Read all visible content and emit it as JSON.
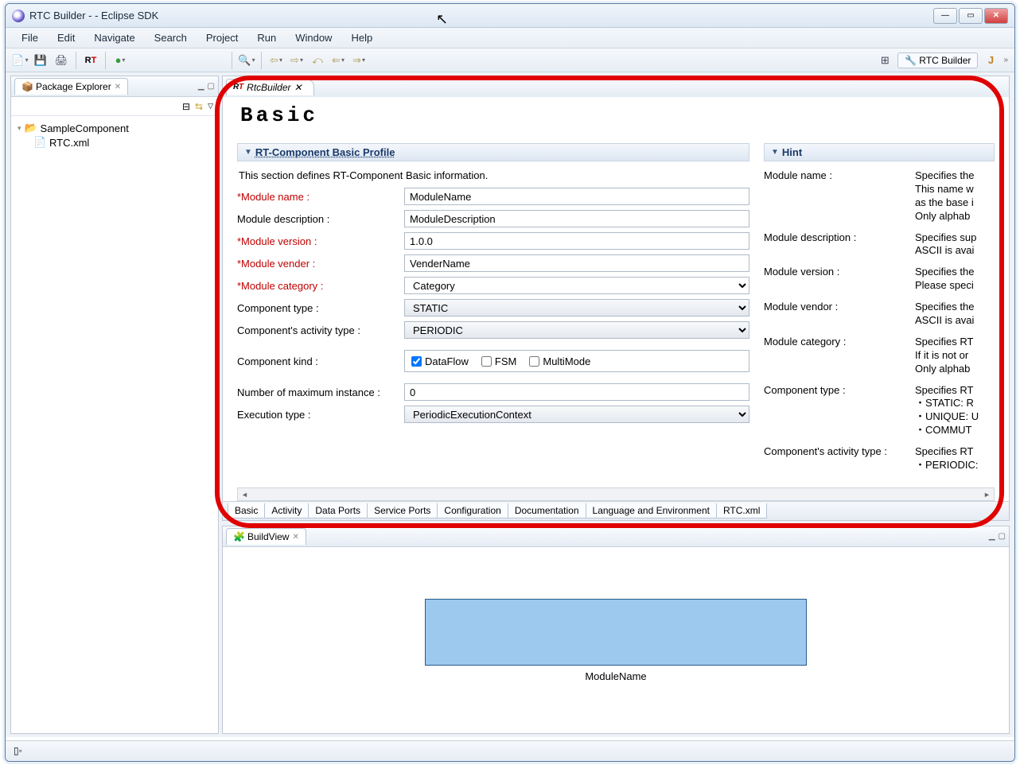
{
  "window": {
    "title": "RTC Builder -  - Eclipse SDK"
  },
  "menu": {
    "file": "File",
    "edit": "Edit",
    "navigate": "Navigate",
    "search": "Search",
    "project": "Project",
    "run": "Run",
    "window": "Window",
    "help": "Help"
  },
  "perspective": {
    "label": "RTC Builder"
  },
  "package_explorer": {
    "title": "Package Explorer",
    "project": "SampleComponent",
    "file": "RTC.xml"
  },
  "editor": {
    "tab": "RtcBuilder",
    "title": "Basic",
    "section_title": "RT-Component Basic Profile",
    "section_desc": "This section defines RT-Component Basic information.",
    "labels": {
      "module_name": "*Module name :",
      "module_desc": "Module description :",
      "module_version": "*Module version :",
      "module_vender": "*Module vender :",
      "module_category": "*Module category :",
      "component_type": "Component type :",
      "activity_type": "Component's activity type :",
      "component_kind": "Component kind :",
      "max_instance": "Number of maximum instance :",
      "exec_type": "Execution type :"
    },
    "values": {
      "module_name": "ModuleName",
      "module_desc": "ModuleDescription",
      "module_version": "1.0.0",
      "module_vender": "VenderName",
      "module_category": "Category",
      "component_type": "STATIC",
      "activity_type": "PERIODIC",
      "max_instance": "0",
      "exec_type": "PeriodicExecutionContext"
    },
    "kind": {
      "dataflow": "DataFlow",
      "fsm": "FSM",
      "multimode": "MultiMode"
    },
    "tabs": {
      "basic": "Basic",
      "activity": "Activity",
      "dataports": "Data Ports",
      "serviceports": "Service Ports",
      "configuration": "Configuration",
      "documentation": "Documentation",
      "langenv": "Language and Environment",
      "rtcxml": "RTC.xml"
    }
  },
  "hint": {
    "title": "Hint",
    "rows": {
      "module_name": {
        "label": "Module name :",
        "text": "Specifies the\nThis name w\nas the base i\nOnly alphab"
      },
      "module_desc": {
        "label": "Module description :",
        "text": "Specifies sup\nASCII is avai"
      },
      "module_version": {
        "label": "Module version :",
        "text": "Specifies the\nPlease speci"
      },
      "module_vendor": {
        "label": "Module vendor :",
        "text": "Specifies the\nASCII is avai"
      },
      "module_category": {
        "label": "Module category :",
        "text": "Specifies RT\nIf it is not or\nOnly alphab"
      },
      "component_type": {
        "label": "Component type :",
        "text": "Specifies RT\n ・STATIC: R\n ・UNIQUE: U\n ・COMMUT"
      },
      "activity_type": {
        "label": "Component's activity type :",
        "text": "Specifies RT\n ・PERIODIC:"
      }
    }
  },
  "buildview": {
    "title": "BuildView",
    "component_label": "ModuleName"
  }
}
